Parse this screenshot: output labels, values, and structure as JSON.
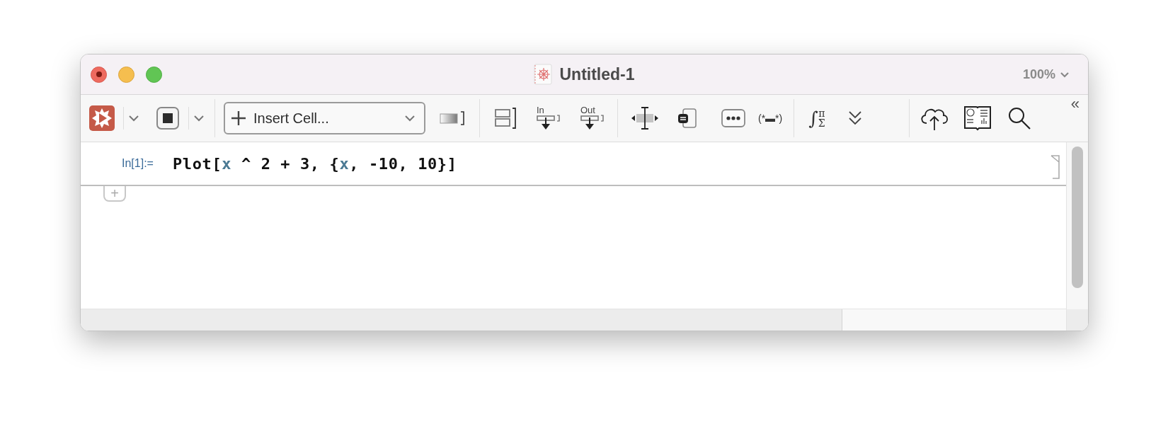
{
  "window": {
    "title": "Untitled-1",
    "zoom": "100%"
  },
  "toolbar": {
    "insert_cell": "Insert Cell...",
    "in_label": "In",
    "out_label": "Out",
    "comment_label": "(*▬*)",
    "math": {
      "integral": "∫",
      "top": "π",
      "bottom": "Σ"
    },
    "collapse": "«"
  },
  "notebook": {
    "cells": [
      {
        "label": "In[1]:=",
        "code": [
          {
            "text": "Plot[",
            "kind": "plain"
          },
          {
            "text": "x",
            "kind": "symbol"
          },
          {
            "text": " ^ 2 + 3, {",
            "kind": "plain"
          },
          {
            "text": "x",
            "kind": "symbol"
          },
          {
            "text": ", -10, 10}]",
            "kind": "plain"
          }
        ]
      }
    ],
    "add_cell": "+"
  }
}
